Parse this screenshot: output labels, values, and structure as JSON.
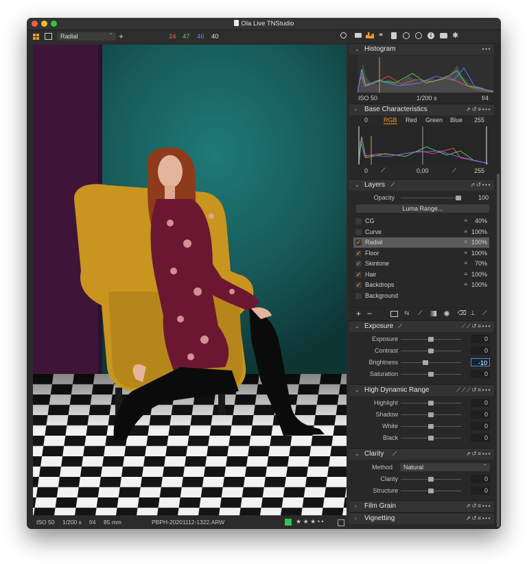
{
  "window": {
    "title": "Ola Live TNStudio"
  },
  "toolbar": {
    "grid_icon": "grid-icon",
    "frame_icon": "frame-icon",
    "tool_select": "Radial",
    "add_icon": "plus-crosshair-icon",
    "rgb_readout": {
      "r": "24",
      "g": "47",
      "b": "46",
      "l": "40"
    },
    "search_icon": "search-icon"
  },
  "panel_tabs": [
    "folder-icon",
    "camera-tool-icon",
    "color-icon",
    "clipboard-icon",
    "lens-icon",
    "search-tab-icon",
    "info-icon",
    "camera-icon",
    "gear-icon"
  ],
  "histogram": {
    "title": "Histogram",
    "iso": "ISO 50",
    "shutter": "1/200 s",
    "aperture": "f/4",
    "more": "•••"
  },
  "base": {
    "title": "Base Characteristics",
    "left_value": "0",
    "tabs": [
      "RGB",
      "Red",
      "Green",
      "Blue"
    ],
    "active_tab": "RGB",
    "right_value": "255",
    "bottom_left": "0",
    "bottom_mid": "0,00",
    "bottom_right": "255"
  },
  "layers": {
    "title": "Layers",
    "opacity_label": "Opacity",
    "opacity_value": "100",
    "opacity_level": 0.95,
    "luma_button": "Luma Range...",
    "items": [
      {
        "name": "CG",
        "checked": false,
        "value": "40%",
        "slider_icon": "≡"
      },
      {
        "name": "Curve",
        "checked": false,
        "value": "100%",
        "slider_icon": "≡"
      },
      {
        "name": "Radial",
        "checked": true,
        "value": "100%",
        "slider_icon": "≡"
      },
      {
        "name": "Floor",
        "checked": true,
        "value": "100%",
        "slider_icon": "≡"
      },
      {
        "name": "Skintone",
        "checked": true,
        "value": "70%",
        "slider_icon": "≡"
      },
      {
        "name": "Hair",
        "checked": true,
        "value": "100%",
        "slider_icon": "≡"
      },
      {
        "name": "Backdrops",
        "checked": true,
        "value": "100%",
        "slider_icon": "≡"
      },
      {
        "name": "Background",
        "checked": false,
        "value": "",
        "slider_icon": ""
      }
    ],
    "selected": "Radial",
    "tools": [
      "+",
      "−",
      "mask-icon",
      "swap-icon",
      "brush-icon",
      "gradient-icon",
      "radial-icon",
      "eraser-icon",
      "stamp-icon",
      "erase-icon"
    ]
  },
  "exposure": {
    "title": "Exposure",
    "sliders": [
      {
        "label": "Exposure",
        "value": "0",
        "level": 0.5
      },
      {
        "label": "Contrast",
        "value": "0",
        "level": 0.5
      },
      {
        "label": "Brightness",
        "value": "-10",
        "level": 0.41,
        "editing": true
      },
      {
        "label": "Saturation",
        "value": "0",
        "level": 0.5
      }
    ]
  },
  "hdr": {
    "title": "High Dynamic Range",
    "sliders": [
      {
        "label": "Highlight",
        "value": "0",
        "level": 0.5
      },
      {
        "label": "Shadow",
        "value": "0",
        "level": 0.5
      },
      {
        "label": "White",
        "value": "0",
        "level": 0.5
      },
      {
        "label": "Black",
        "value": "0",
        "level": 0.5
      }
    ]
  },
  "clarity": {
    "title": "Clarity",
    "method_label": "Method",
    "method_value": "Natural",
    "sliders": [
      {
        "label": "Clarity",
        "value": "0",
        "level": 0.5
      },
      {
        "label": "Structure",
        "value": "0",
        "level": 0.5
      }
    ]
  },
  "film_grain": {
    "title": "Film Grain"
  },
  "vignetting": {
    "title": "Vignetting"
  },
  "status": {
    "iso": "ISO 50",
    "shutter": "1/200 s",
    "aperture": "f/4",
    "focal": "85 mm",
    "filename": "PBPH-20201112-1322.ARW",
    "color_tag": "#2ec25b",
    "stars": "★ ★ ★ • •"
  },
  "colors": {
    "accent": "#f19b2c",
    "panel": "#282828",
    "selected_row": "#5b5b5b",
    "edit_border": "#2f8ff3"
  }
}
